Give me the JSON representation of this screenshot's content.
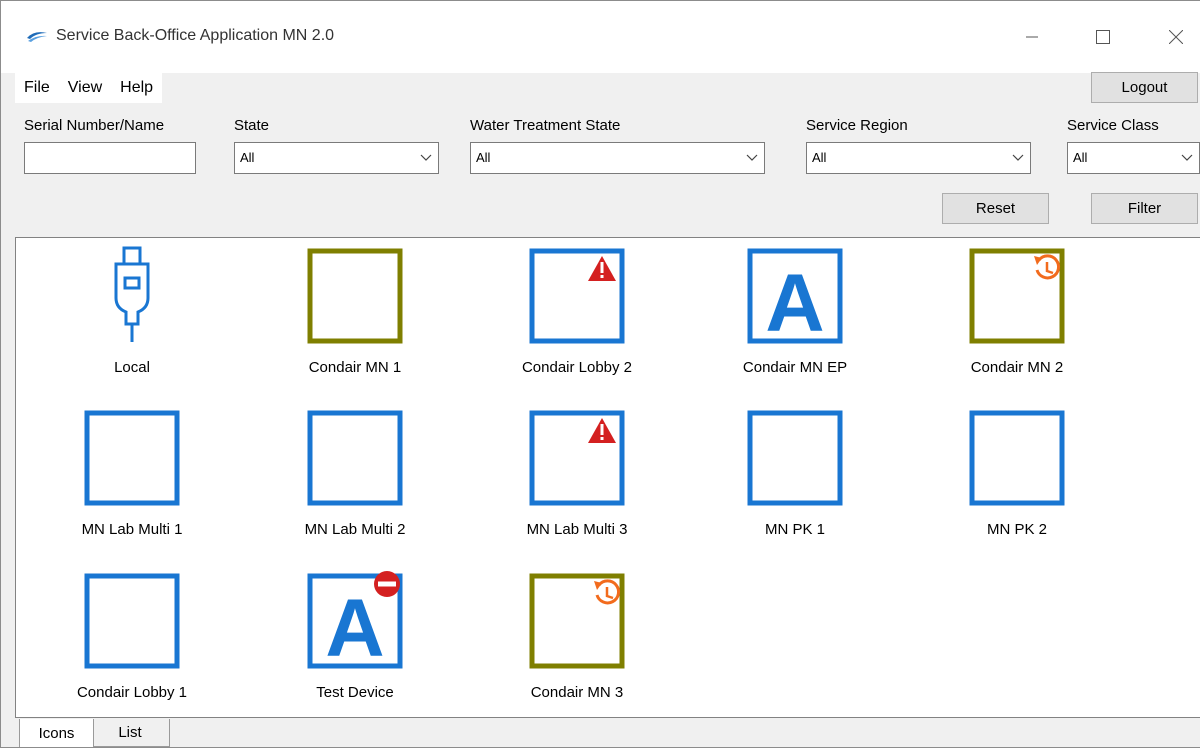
{
  "window": {
    "title": "Service Back-Office Application MN 2.0"
  },
  "menu": [
    "File",
    "View",
    "Help"
  ],
  "logout_label": "Logout",
  "filters": {
    "serial_label": "Serial Number/Name",
    "serial_value": "",
    "state_label": "State",
    "state_value": "All",
    "water_label": "Water Treatment State",
    "water_value": "All",
    "region_label": "Service Region",
    "region_value": "All",
    "class_label": "Service Class",
    "class_value": "All"
  },
  "reset_label": "Reset",
  "filter_label": "Filter",
  "devices": [
    {
      "name": "Local",
      "icon": "usb-connector-icon",
      "frame_color": "#1976d2",
      "badge": "none"
    },
    {
      "name": "Condair MN 1",
      "icon": "device-square-icon",
      "frame_color": "#7f7f00",
      "badge": "none"
    },
    {
      "name": "Condair Lobby 2",
      "icon": "device-square-icon",
      "frame_color": "#1976d2",
      "badge": "warning-icon"
    },
    {
      "name": "Condair MN EP",
      "icon": "device-letter-a-icon",
      "frame_color": "#1976d2",
      "badge": "none"
    },
    {
      "name": "Condair MN 2",
      "icon": "device-square-icon",
      "frame_color": "#7f7f00",
      "badge": "history-icon"
    },
    {
      "name": "MN Lab Multi 1",
      "icon": "device-square-icon",
      "frame_color": "#1976d2",
      "badge": "none"
    },
    {
      "name": "MN Lab Multi 2",
      "icon": "device-square-icon",
      "frame_color": "#1976d2",
      "badge": "none"
    },
    {
      "name": "MN Lab Multi 3",
      "icon": "device-square-icon",
      "frame_color": "#1976d2",
      "badge": "warning-icon"
    },
    {
      "name": "MN PK 1",
      "icon": "device-square-icon",
      "frame_color": "#1976d2",
      "badge": "none"
    },
    {
      "name": "MN PK 2",
      "icon": "device-square-icon",
      "frame_color": "#1976d2",
      "badge": "none"
    },
    {
      "name": "Condair Lobby 1",
      "icon": "device-square-icon",
      "frame_color": "#1976d2",
      "badge": "none"
    },
    {
      "name": "Test Device",
      "icon": "device-letter-a-icon",
      "frame_color": "#1976d2",
      "badge": "blocked-icon"
    },
    {
      "name": "Condair MN 3",
      "icon": "device-square-icon",
      "frame_color": "#7f7f00",
      "badge": "history-icon"
    }
  ],
  "tabs": [
    {
      "label": "Icons",
      "active": true
    },
    {
      "label": "List",
      "active": false
    }
  ]
}
